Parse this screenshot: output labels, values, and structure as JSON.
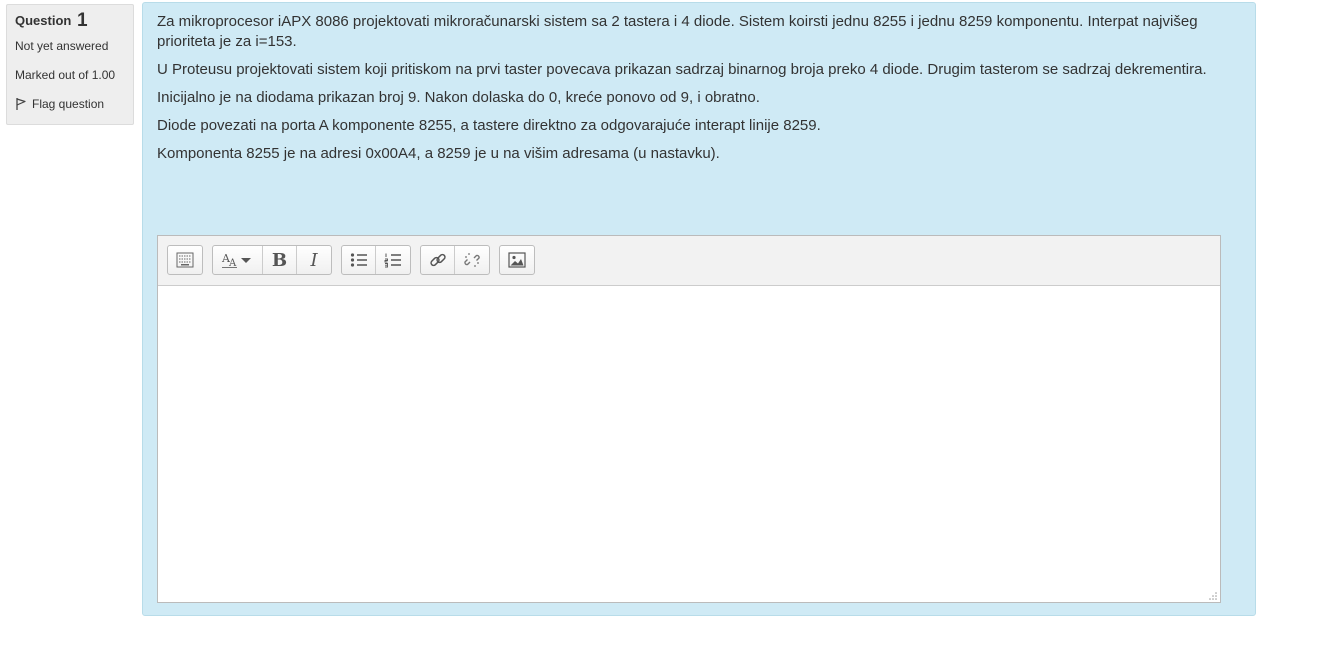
{
  "info": {
    "question_label": "Question",
    "question_number": "1",
    "state": "Not yet answered",
    "grade": "Marked out of 1.00",
    "flag_label": "Flag question"
  },
  "question": {
    "paragraphs": [
      "Za mikroprocesor iAPX 8086 projektovati mikroračunarski sistem sa 2 tastera i 4 diode. Sistem koirsti jednu 8255 i jednu 8259 komponentu. Interpat najvišeg prioriteta je za i=153.",
      "U Proteusu projektovati sistem koji pritiskom na prvi taster povecava prikazan sadrzaj binarnog broja preko 4 diode. Drugim tasterom se sadrzaj dekrementira.",
      "Inicijalno je na diodama prikazan broj 9. Nakon dolaska do 0, kreće ponovo od 9, i obratno.",
      "Diode povezati na porta A komponente 8255, a tastere direktno za odgovarajuće interapt linije 8259.",
      "Komponenta 8255 je na adresi 0x00A4, a 8259 je u na višim adresama (u nastavku)."
    ]
  },
  "editor": {
    "toolbar": {
      "bold_label": "B",
      "italic_label": "I"
    },
    "value": ""
  },
  "colors": {
    "content_bg": "#cfeaf5",
    "info_bg": "#eeeeee",
    "text": "#333333"
  }
}
